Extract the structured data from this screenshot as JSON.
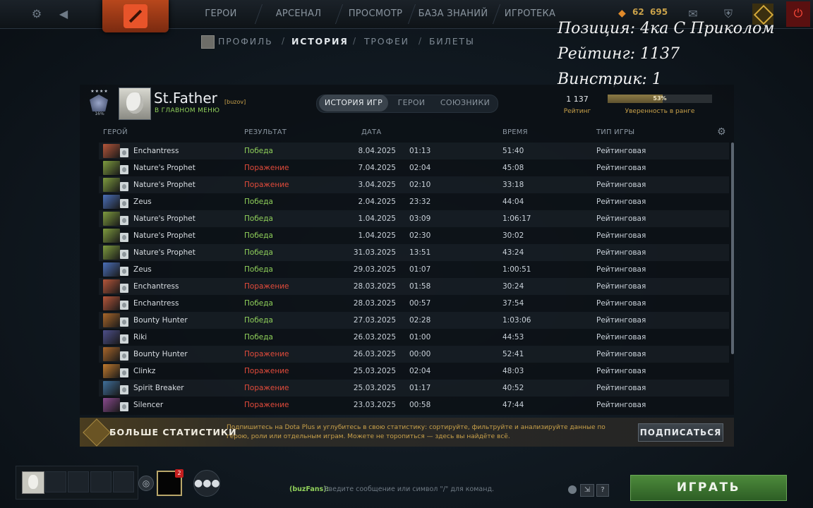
{
  "topnav": {
    "tabs": [
      "ГЕРОИ",
      "АРСЕНАЛ",
      "ПРОСМОТР",
      "БАЗА ЗНАНИЙ",
      "ИГРОТЕКА"
    ],
    "shards": "62",
    "gold": "695"
  },
  "subnav": {
    "tabs": [
      "ПРОФИЛЬ",
      "ИСТОРИЯ",
      "ТРОФЕИ",
      "БИЛЕТЫ"
    ],
    "separator": "/"
  },
  "overlay": {
    "position": "Позиция: 4ка С Приколом",
    "rating": "Рейтинг: 1137",
    "winstreak": "Винстрик: 1"
  },
  "profile": {
    "name": "St.Father",
    "tag": "[buzov]",
    "status": "В ГЛАВНОМ МЕНЮ",
    "rank_percent": "16%",
    "rank_stars": "4",
    "rating_value": "1 137",
    "rating_label": "Рейтинг",
    "confidence_value": "53%",
    "confidence_fraction": 0.53,
    "confidence_label": "Уверенность в ранге"
  },
  "history_tabs": [
    "ИСТОРИЯ ИГР",
    "ГЕРОИ",
    "СОЮЗНИКИ"
  ],
  "columns": {
    "hero": "ГЕРОЙ",
    "result": "РЕЗУЛЬТАТ",
    "date": "ДАТА",
    "time": "ВРЕМЯ",
    "type": "ТИП ИГРЫ"
  },
  "matches": [
    {
      "hero": "Enchantress",
      "result": "Победа",
      "win": true,
      "date": "8.04.2025",
      "start": "01:13",
      "duration": "51:40",
      "type": "Рейтинговая",
      "color": "#b5563a"
    },
    {
      "hero": "Nature's Prophet",
      "result": "Поражение",
      "win": false,
      "date": "7.04.2025",
      "start": "02:04",
      "duration": "45:08",
      "type": "Рейтинговая",
      "color": "#7e9b3e"
    },
    {
      "hero": "Nature's Prophet",
      "result": "Поражение",
      "win": false,
      "date": "3.04.2025",
      "start": "02:10",
      "duration": "33:18",
      "type": "Рейтинговая",
      "color": "#7e9b3e"
    },
    {
      "hero": "Zeus",
      "result": "Победа",
      "win": true,
      "date": "2.04.2025",
      "start": "23:32",
      "duration": "44:04",
      "type": "Рейтинговая",
      "color": "#4a6fb8"
    },
    {
      "hero": "Nature's Prophet",
      "result": "Победа",
      "win": true,
      "date": "1.04.2025",
      "start": "03:09",
      "duration": "1:06:17",
      "type": "Рейтинговая",
      "color": "#7e9b3e"
    },
    {
      "hero": "Nature's Prophet",
      "result": "Победа",
      "win": true,
      "date": "1.04.2025",
      "start": "02:30",
      "duration": "30:02",
      "type": "Рейтинговая",
      "color": "#7e9b3e"
    },
    {
      "hero": "Nature's Prophet",
      "result": "Победа",
      "win": true,
      "date": "31.03.2025",
      "start": "13:51",
      "duration": "43:24",
      "type": "Рейтинговая",
      "color": "#7e9b3e"
    },
    {
      "hero": "Zeus",
      "result": "Победа",
      "win": true,
      "date": "29.03.2025",
      "start": "01:07",
      "duration": "1:00:51",
      "type": "Рейтинговая",
      "color": "#4a6fb8"
    },
    {
      "hero": "Enchantress",
      "result": "Поражение",
      "win": false,
      "date": "28.03.2025",
      "start": "01:58",
      "duration": "30:24",
      "type": "Рейтинговая",
      "color": "#b5563a"
    },
    {
      "hero": "Enchantress",
      "result": "Победа",
      "win": true,
      "date": "28.03.2025",
      "start": "00:57",
      "duration": "37:54",
      "type": "Рейтинговая",
      "color": "#b5563a"
    },
    {
      "hero": "Bounty Hunter",
      "result": "Победа",
      "win": true,
      "date": "27.03.2025",
      "start": "02:28",
      "duration": "1:03:06",
      "type": "Рейтинговая",
      "color": "#a8662a"
    },
    {
      "hero": "Riki",
      "result": "Победа",
      "win": true,
      "date": "26.03.2025",
      "start": "01:00",
      "duration": "44:53",
      "type": "Рейтинговая",
      "color": "#4d4f8a"
    },
    {
      "hero": "Bounty Hunter",
      "result": "Поражение",
      "win": false,
      "date": "26.03.2025",
      "start": "00:00",
      "duration": "52:41",
      "type": "Рейтинговая",
      "color": "#a8662a"
    },
    {
      "hero": "Clinkz",
      "result": "Поражение",
      "win": false,
      "date": "25.03.2025",
      "start": "02:04",
      "duration": "48:03",
      "type": "Рейтинговая",
      "color": "#c07a2e"
    },
    {
      "hero": "Spirit Breaker",
      "result": "Поражение",
      "win": false,
      "date": "25.03.2025",
      "start": "01:17",
      "duration": "40:52",
      "type": "Рейтинговая",
      "color": "#3f6f9a"
    },
    {
      "hero": "Silencer",
      "result": "Поражение",
      "win": false,
      "date": "23.03.2025",
      "start": "00:58",
      "duration": "47:44",
      "type": "Рейтинговая",
      "color": "#8a4a8e"
    }
  ],
  "plus": {
    "title": "БОЛЬШЕ СТАТИСТИКИ",
    "text1": "Подпишитесь на Dota Plus и углубитесь в свою статистику: сортируйте, фильтруйте и анализируйте данные по",
    "text2": "герою, роли или отдельным играм. Можете не торопиться — здесь вы найдёте всё.",
    "button": "ПОДПИСАТЬСЯ"
  },
  "chat": {
    "channel": "(buzFans):",
    "placeholder": "Введите сообщение или символ \"/\" для команд."
  },
  "party": {
    "notification_count": "2"
  },
  "play_button": "ИГРАТЬ",
  "help": "?",
  "colors": {
    "win": "#8fcf5a",
    "loss": "#e24b3b",
    "accent_gold": "#c9a14a",
    "play_green": "#3f7a32"
  }
}
